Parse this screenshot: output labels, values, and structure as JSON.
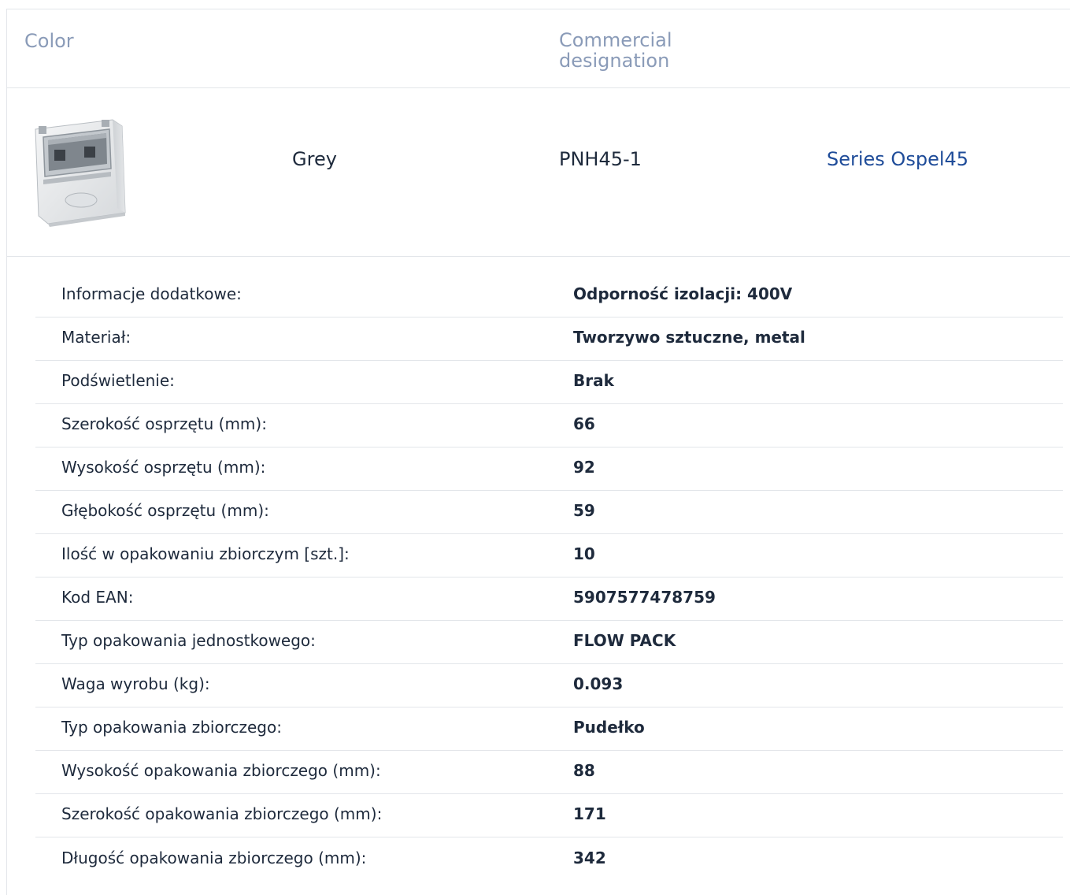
{
  "header": {
    "color_label": "Color",
    "commercial_label": "Commercial designation"
  },
  "product": {
    "image_icon": "enclosure-product-photo",
    "color": "Grey",
    "code": "PNH45-1",
    "series_link": "Series Ospel45"
  },
  "specs": [
    {
      "label": "Informacje dodatkowe:",
      "value": "Odporność izolacji: 400V"
    },
    {
      "label": "Materiał:",
      "value": "Tworzywo sztuczne, metal"
    },
    {
      "label": "Podświetlenie:",
      "value": "Brak"
    },
    {
      "label": "Szerokość osprzętu (mm):",
      "value": "66"
    },
    {
      "label": "Wysokość osprzętu (mm):",
      "value": "92"
    },
    {
      "label": "Głębokość osprzętu (mm):",
      "value": "59"
    },
    {
      "label": "Ilość w opakowaniu zbiorczym [szt.]:",
      "value": "10"
    },
    {
      "label": "Kod EAN:",
      "value": "5907577478759"
    },
    {
      "label": "Typ opakowania jednostkowego:",
      "value": "FLOW PACK"
    },
    {
      "label": "Waga wyrobu (kg):",
      "value": "0.093"
    },
    {
      "label": "Typ opakowania zbiorczego:",
      "value": "Pudełko"
    },
    {
      "label": "Wysokość opakowania zbiorczego (mm):",
      "value": "88"
    },
    {
      "label": "Szerokość opakowania zbiorczego (mm):",
      "value": "171"
    },
    {
      "label": "Długość opakowania zbiorczego (mm):",
      "value": "342"
    }
  ],
  "colors": {
    "header_text": "#8a9bb8",
    "body_text": "#1e2a3c",
    "link": "#1f4c99",
    "divider": "#e3e6ea"
  }
}
